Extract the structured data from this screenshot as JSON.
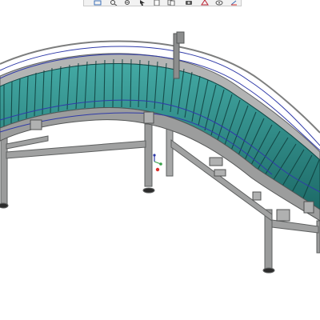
{
  "app": {
    "view": "3d-model-viewport"
  },
  "toolbar": {
    "buttons": [
      {
        "icon": "zoom-fit-icon"
      },
      {
        "icon": "zoom-in-icon"
      },
      {
        "icon": "zoom-out-icon"
      },
      {
        "icon": "select-icon"
      },
      {
        "icon": "page-icon"
      },
      {
        "icon": "page-copy-icon"
      },
      {
        "icon": "camera-icon"
      },
      {
        "icon": "measure-icon"
      },
      {
        "icon": "view-icon"
      },
      {
        "icon": "axis-icon"
      }
    ]
  },
  "colors": {
    "frame": "#8f9090",
    "frame_dark": "#555757",
    "frame_light": "#c4c5c5",
    "roller": "#2f8a86",
    "roller_dark": "#124a48",
    "guide_wire": "#2f3aa8",
    "accent_red": "#d9302c",
    "accent_green": "#3aa04a"
  }
}
